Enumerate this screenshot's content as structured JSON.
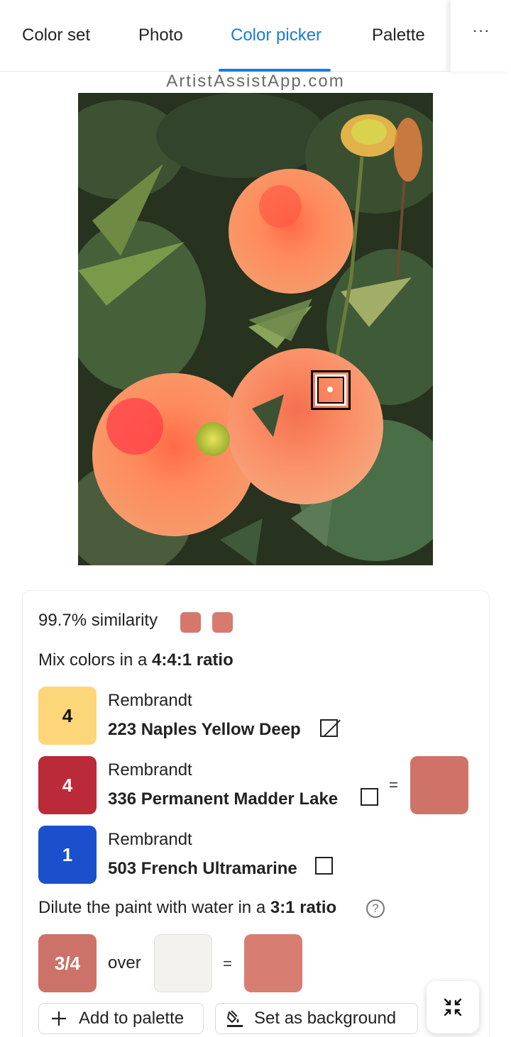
{
  "tabs": [
    {
      "label": "Color set",
      "active": false
    },
    {
      "label": "Photo",
      "active": false
    },
    {
      "label": "Color picker",
      "active": true
    },
    {
      "label": "Palette",
      "active": false
    }
  ],
  "more_label": "···",
  "watermark": "ArtistAssistApp.com",
  "result": {
    "similarity_value": "99.7%",
    "similarity_label": "similarity",
    "target_color": "#d5776b",
    "matched_color": "#d97a70",
    "mix_prefix": "Mix colors in a",
    "mix_ratio": "4:4:1 ratio",
    "paints": [
      {
        "count": "4",
        "brand": "Rembrandt",
        "name": "223 Naples Yellow Deep",
        "color": "#fdd67a",
        "text_color": "#111111",
        "checkbox": "opaque"
      },
      {
        "count": "4",
        "brand": "Rembrandt",
        "name": "336 Permanent Madder Lake",
        "color": "#bb2a38",
        "text_color": "#ffffff",
        "checkbox": "empty"
      },
      {
        "count": "1",
        "brand": "Rembrandt",
        "name": "503 French Ultramarine",
        "color": "#1b4fcc",
        "text_color": "#ffffff",
        "checkbox": "empty"
      }
    ],
    "mix_equals": "=",
    "mix_result_color": "#cf7368",
    "dilute_prefix": "Dilute the paint with water in a",
    "dilute_ratio": "3:1 ratio",
    "dilute_help": "?",
    "dilute_fraction": "3/4",
    "dilute_fraction_color": "#cd7268",
    "dilute_over": "over",
    "paper_color": "#f3f2ee",
    "dilute_equals": "=",
    "dilute_result_color": "#d87d72"
  },
  "buttons": {
    "add_to_palette": "Add to palette",
    "set_as_background": "Set as background"
  },
  "icons": {
    "add": "plus-icon",
    "background": "paint-bucket-icon",
    "fullscreen_exit": "collapse-arrows-icon"
  }
}
